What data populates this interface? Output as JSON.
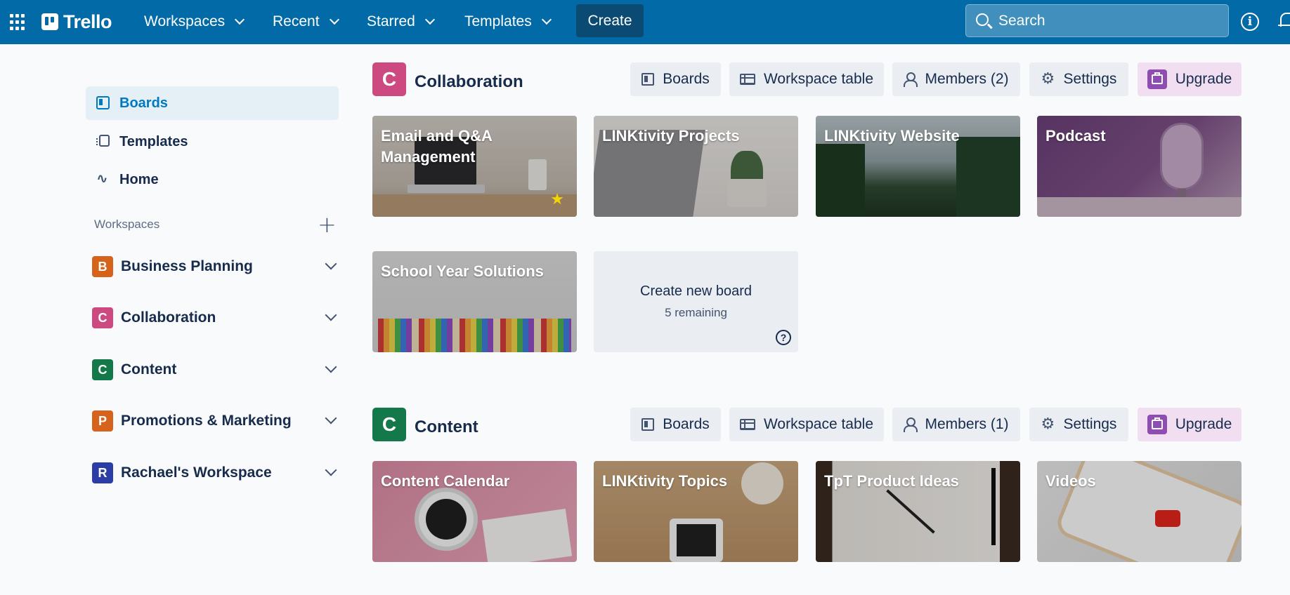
{
  "topbar": {
    "apps_icon": "apps-grid-icon",
    "logo_text": "Trello",
    "nav": [
      {
        "label": "Workspaces"
      },
      {
        "label": "Recent"
      },
      {
        "label": "Starred"
      },
      {
        "label": "Templates"
      }
    ],
    "create_label": "Create",
    "search_placeholder": "Search",
    "info_icon": "info-icon",
    "notifications_icon": "bell-icon",
    "color": "#026aa7"
  },
  "sidebar": {
    "items": [
      {
        "label": "Boards",
        "icon": "boards-icon",
        "active": true
      },
      {
        "label": "Templates",
        "icon": "templates-icon"
      },
      {
        "label": "Home",
        "icon": "activity-icon"
      }
    ],
    "workspaces_header": "Workspaces",
    "workspaces": [
      {
        "initial": "B",
        "name": "Business Planning",
        "color": "#d5631b"
      },
      {
        "initial": "C",
        "name": "Collaboration",
        "color": "#cd4a80"
      },
      {
        "initial": "C",
        "name": "Content",
        "color": "#13784a"
      },
      {
        "initial": "P",
        "name": "Promotions & Marketing",
        "color": "#d5631b"
      },
      {
        "initial": "R",
        "name": "Rachael's Workspace",
        "color": "#2c3ea6"
      }
    ]
  },
  "sections": [
    {
      "initial": "C",
      "title": "Collaboration",
      "color": "#cd4a80",
      "buttons": {
        "boards": "Boards",
        "table": "Workspace table",
        "members": "Members (2)",
        "settings": "Settings",
        "upgrade": "Upgrade"
      },
      "boards": [
        {
          "title": "Email and Q&A Management",
          "starred": true
        },
        {
          "title": "LINKtivity Projects"
        },
        {
          "title": "LINKtivity Website"
        },
        {
          "title": "Podcast"
        },
        {
          "title": "School Year Solutions"
        }
      ],
      "create": {
        "title": "Create new board",
        "remaining": "5 remaining",
        "help": "?"
      }
    },
    {
      "initial": "C",
      "title": "Content",
      "color": "#13784a",
      "buttons": {
        "boards": "Boards",
        "table": "Workspace table",
        "members": "Members (1)",
        "settings": "Settings",
        "upgrade": "Upgrade"
      },
      "boards": [
        {
          "title": "Content Calendar"
        },
        {
          "title": "LINKtivity Topics"
        },
        {
          "title": "TpT Product Ideas"
        },
        {
          "title": "Videos"
        }
      ]
    }
  ]
}
